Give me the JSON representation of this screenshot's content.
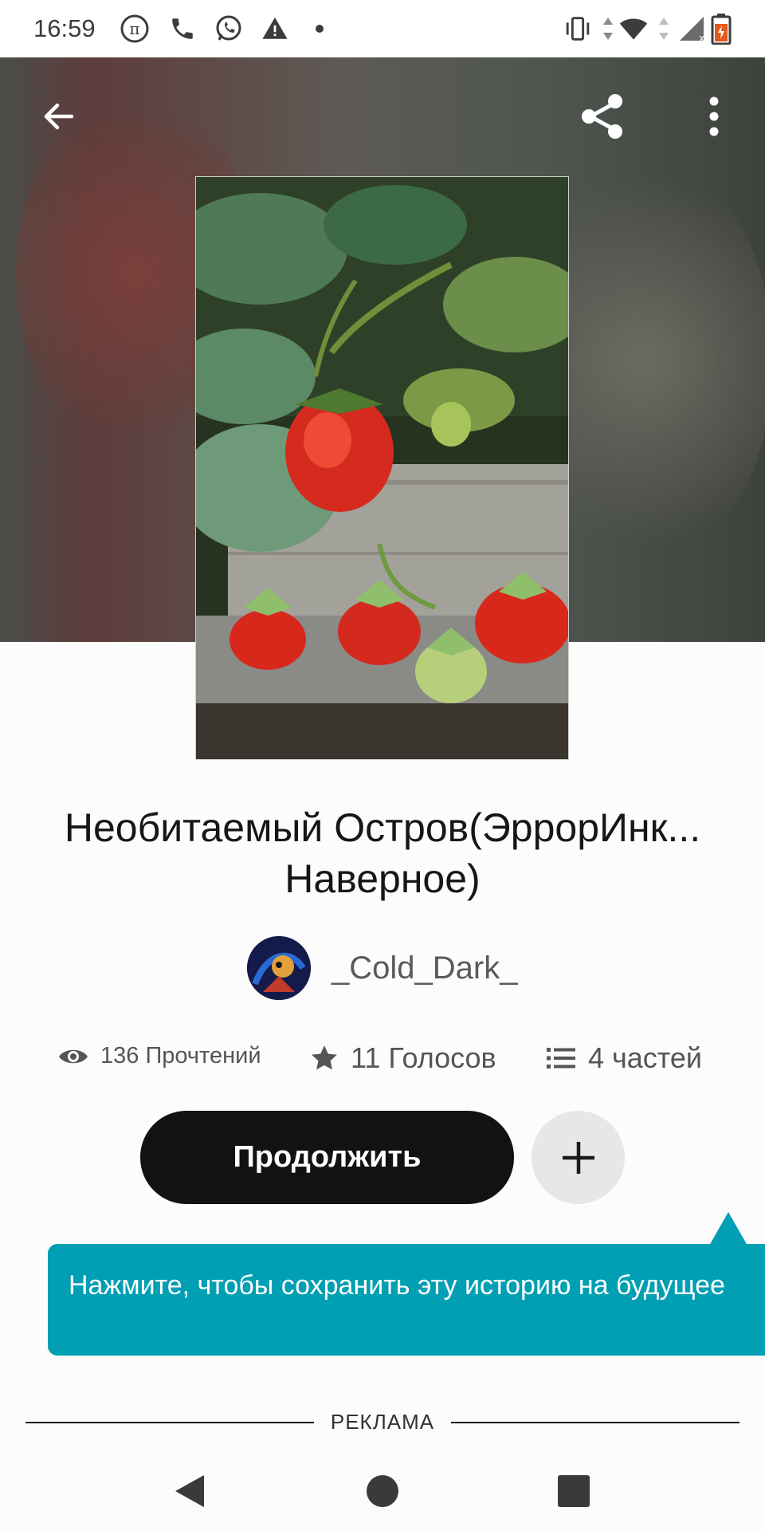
{
  "status_bar": {
    "time": "16:59",
    "left_icons": [
      "pi-icon",
      "phone-icon",
      "whatsapp-icon",
      "warning-icon",
      "dot-icon"
    ],
    "right_icons": [
      "vibrate-icon",
      "data-arrows-icon",
      "wifi-icon",
      "signal-icon",
      "battery-icon"
    ]
  },
  "toolbar": {
    "back": "back-arrow-icon",
    "share": "share-icon",
    "more": "more-vertical-icon"
  },
  "story": {
    "title": "Необитаемый Остров(ЭррорИнк... Наверное)",
    "author": "_Cold_Dark_",
    "reads": "136 Прочтений",
    "votes": "11 Голосов",
    "parts": "4 частей"
  },
  "actions": {
    "continue_label": "Продолжить",
    "add_icon": "plus-icon"
  },
  "tooltip": {
    "text": "Нажмите, чтобы сохранить эту историю на будущее"
  },
  "ad": {
    "label": "РЕКЛАМА"
  },
  "colors": {
    "accent": "#009fb3",
    "button_dark": "#121212",
    "add_button_bg": "#e8e6e9"
  }
}
